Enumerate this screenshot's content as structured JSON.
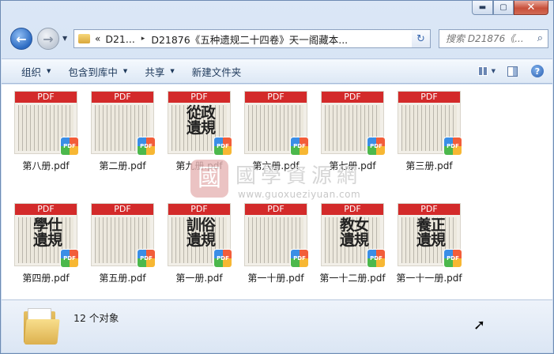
{
  "window": {
    "caption": {
      "minimize": "▬",
      "maximize": "▢",
      "close": "✕"
    }
  },
  "address": {
    "crumb1": "D21...",
    "crumb2": "D21876《五种遗规二十四卷》天一阁藏本...",
    "back_glyph": "←",
    "forward_glyph": "→",
    "refresh_glyph": "↻",
    "chevrons": "«",
    "separator": "▸"
  },
  "search": {
    "placeholder": "搜索 D21876《...",
    "icon": "search-icon"
  },
  "toolbar": {
    "organize": "组织",
    "include_library": "包含到库中",
    "share": "共享",
    "new_folder": "新建文件夹",
    "help": "?"
  },
  "watermark": {
    "seal": "國",
    "title": "國學資源網",
    "url": "www.guoxueziyuan.com"
  },
  "files": [
    {
      "name": "第八册.pdf",
      "band": "PDF",
      "title": ""
    },
    {
      "name": "第二册.pdf",
      "band": "PDF",
      "title": ""
    },
    {
      "name": "第九册.pdf",
      "band": "PDF",
      "title": "從政遺規"
    },
    {
      "name": "第六册.pdf",
      "band": "PDF",
      "title": ""
    },
    {
      "name": "第七册.pdf",
      "band": "PDF",
      "title": ""
    },
    {
      "name": "第三册.pdf",
      "band": "PDF",
      "title": ""
    },
    {
      "name": "第四册.pdf",
      "band": "PDF",
      "title": "學仕遺規"
    },
    {
      "name": "第五册.pdf",
      "band": "PDF",
      "title": ""
    },
    {
      "name": "第一册.pdf",
      "band": "PDF",
      "title": "訓俗遺規"
    },
    {
      "name": "第一十册.pdf",
      "band": "PDF",
      "title": ""
    },
    {
      "name": "第一十二册.pdf",
      "band": "PDF",
      "title": "教女遺規"
    },
    {
      "name": "第一十一册.pdf",
      "band": "PDF",
      "title": "養正遺規"
    }
  ],
  "status": {
    "count": "12 个对象"
  }
}
